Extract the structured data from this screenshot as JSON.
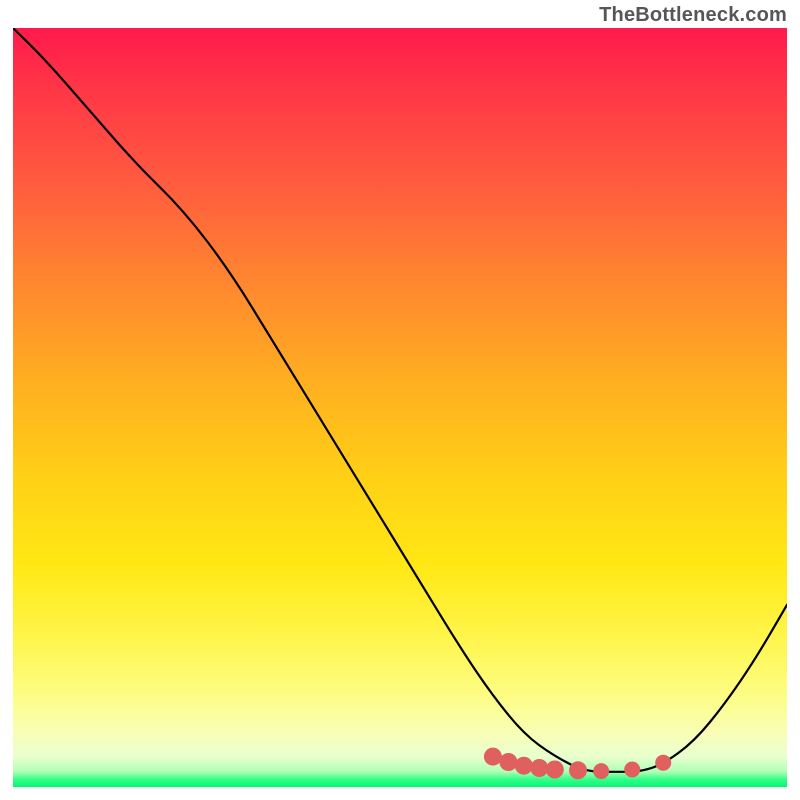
{
  "attribution": "TheBottleneck.com",
  "chart_data": {
    "type": "line",
    "title": "",
    "xlabel": "",
    "ylabel": "",
    "xlim": [
      0,
      100
    ],
    "ylim": [
      0,
      100
    ],
    "grid": false,
    "series": [
      {
        "name": "curve",
        "color": "#000000",
        "x": [
          0,
          4,
          10,
          16,
          22,
          28,
          34,
          40,
          46,
          52,
          58,
          62,
          66,
          70,
          74,
          78,
          81,
          84,
          88,
          92,
          96,
          100
        ],
        "y": [
          100,
          96,
          89,
          82,
          76,
          68,
          58,
          48,
          38,
          28,
          18,
          12,
          7,
          4,
          2,
          2,
          2,
          3,
          6,
          11,
          17,
          24
        ]
      }
    ],
    "markers": [
      {
        "name": "segment-a-start",
        "x": 62,
        "y": 4.0,
        "color": "#e06060",
        "size": 9
      },
      {
        "name": "segment-a-mid1",
        "x": 64,
        "y": 3.3,
        "color": "#e06060",
        "size": 9
      },
      {
        "name": "segment-a-mid2",
        "x": 66,
        "y": 2.8,
        "color": "#e06060",
        "size": 9
      },
      {
        "name": "segment-a-end",
        "x": 68,
        "y": 2.5,
        "color": "#e06060",
        "size": 9
      },
      {
        "name": "segment-b-start",
        "x": 70,
        "y": 2.3,
        "color": "#e06060",
        "size": 9
      },
      {
        "name": "segment-b-end",
        "x": 73,
        "y": 2.2,
        "color": "#e06060",
        "size": 9
      },
      {
        "name": "point-c",
        "x": 76,
        "y": 2.1,
        "color": "#e06060",
        "size": 8
      },
      {
        "name": "point-d",
        "x": 80,
        "y": 2.3,
        "color": "#e06060",
        "size": 8
      },
      {
        "name": "point-e",
        "x": 84,
        "y": 3.2,
        "color": "#e06060",
        "size": 8
      }
    ],
    "background": {
      "type": "vertical-gradient",
      "stops": [
        {
          "pos": 0,
          "color": "#ff1a4c"
        },
        {
          "pos": 50,
          "color": "#ffd215"
        },
        {
          "pos": 95,
          "color": "#f8feb6"
        },
        {
          "pos": 100,
          "color": "#08f573"
        }
      ]
    }
  }
}
